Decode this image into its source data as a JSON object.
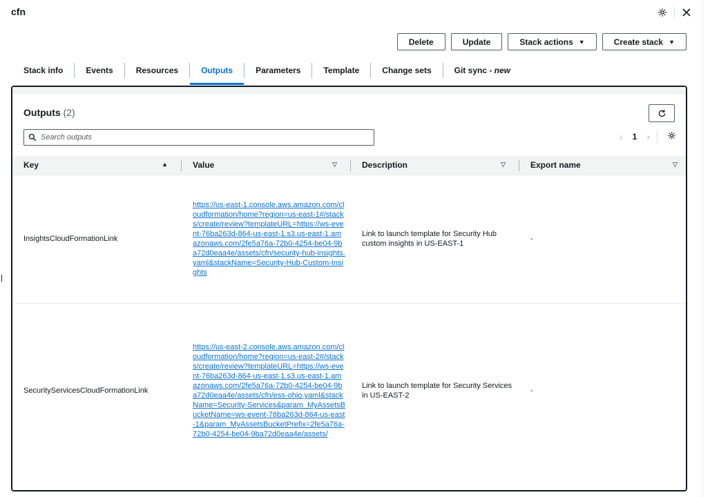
{
  "header": {
    "title": "cfn",
    "settings_icon": "gear-icon",
    "close_icon": "close-icon"
  },
  "actions": {
    "delete": "Delete",
    "update": "Update",
    "stack_actions": "Stack actions",
    "create_stack": "Create stack"
  },
  "tabs": [
    {
      "label": "Stack info"
    },
    {
      "label": "Events"
    },
    {
      "label": "Resources"
    },
    {
      "label": "Outputs",
      "active": true
    },
    {
      "label": "Parameters"
    },
    {
      "label": "Template"
    },
    {
      "label": "Change sets"
    },
    {
      "label": "Git sync - ",
      "suffix": "new"
    }
  ],
  "outputs": {
    "title": "Outputs",
    "count": "(2)",
    "search_placeholder": "Search outputs",
    "page": "1",
    "columns": {
      "key": "Key",
      "value": "Value",
      "description": "Description",
      "export": "Export name"
    },
    "rows": [
      {
        "key": "InsightsCloudFormationLink",
        "value": "https://us-east-1.console.aws.amazon.com/cloudformation/home?region=us-east-1#/stacks/create/review?templateURL=https://ws-event-76ba263d-864-us-east-1.s3.us-east-1.amazonaws.com/2fe5a76a-72b0-4254-be04-9ba72d0eaa4e/assets/cfn/security-hub-insights.yaml&stackName=Security-Hub-Custom-Insights",
        "description": "Link to launch template for Security Hub custom insights in US-EAST-1",
        "export": "-"
      },
      {
        "key": "SecurityServicesCloudFormationLink",
        "value": "https://us-east-2.console.aws.amazon.com/cloudformation/home?region=us-east-2#/stacks/create/review?templateURL=https://ws-event-76ba263d-864-us-east-1.s3.us-east-1.amazonaws.com/2fe5a76a-72b0-4254-be04-9ba72d0eaa4e/assets/cfn/ess-ohio.yaml&stackName=Security-Services&param_MyAssetsBucketName=ws-event-76ba263d-864-us-east-1&param_MyAssetsBucketPrefix=2fe5a76a-72b0-4254-be04-9ba72d0eaa4e/assets/",
        "description": "Link to launch template for Security Services in US-EAST-2",
        "export": "-"
      }
    ]
  }
}
